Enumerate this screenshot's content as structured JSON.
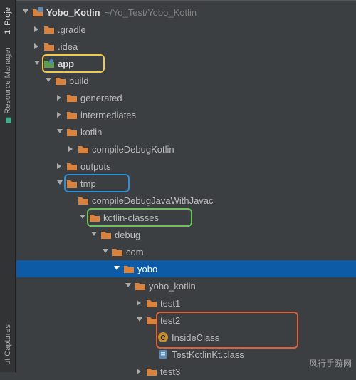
{
  "gutter": {
    "project_tab": "1: Proje",
    "resource_mgr_tab": "Resource Manager",
    "captures_tab": "ut Captures"
  },
  "root": {
    "name": "Yobo_Kotlin",
    "path": "~/Yo_Test/Yobo_Kotlin"
  },
  "tree": {
    "gradle": ".gradle",
    "idea": ".idea",
    "app": "app",
    "build": "build",
    "generated": "generated",
    "intermediates": "intermediates",
    "kotlin": "kotlin",
    "compileDebugKotlin": "compileDebugKotlin",
    "outputs": "outputs",
    "tmp": "tmp",
    "compileDebugJavaWithJavac": "compileDebugJavaWithJavac",
    "kotlinClasses": "kotlin-classes",
    "debug": "debug",
    "com": "com",
    "yobo": "yobo",
    "yobo_kotlin": "yobo_kotlin",
    "test1": "test1",
    "test2": "test2",
    "insideClass": "InsideClass",
    "testKotlinKt": "TestKotlinKt.class",
    "test3": "test3"
  },
  "watermark": "风行手游网",
  "colors": {
    "folder": "#d9823b",
    "module": "#5b9e4f",
    "classOrb": "#c78f2b",
    "fileBlue": "#5b8bb5",
    "selected_bg": "#0d5aa7"
  }
}
